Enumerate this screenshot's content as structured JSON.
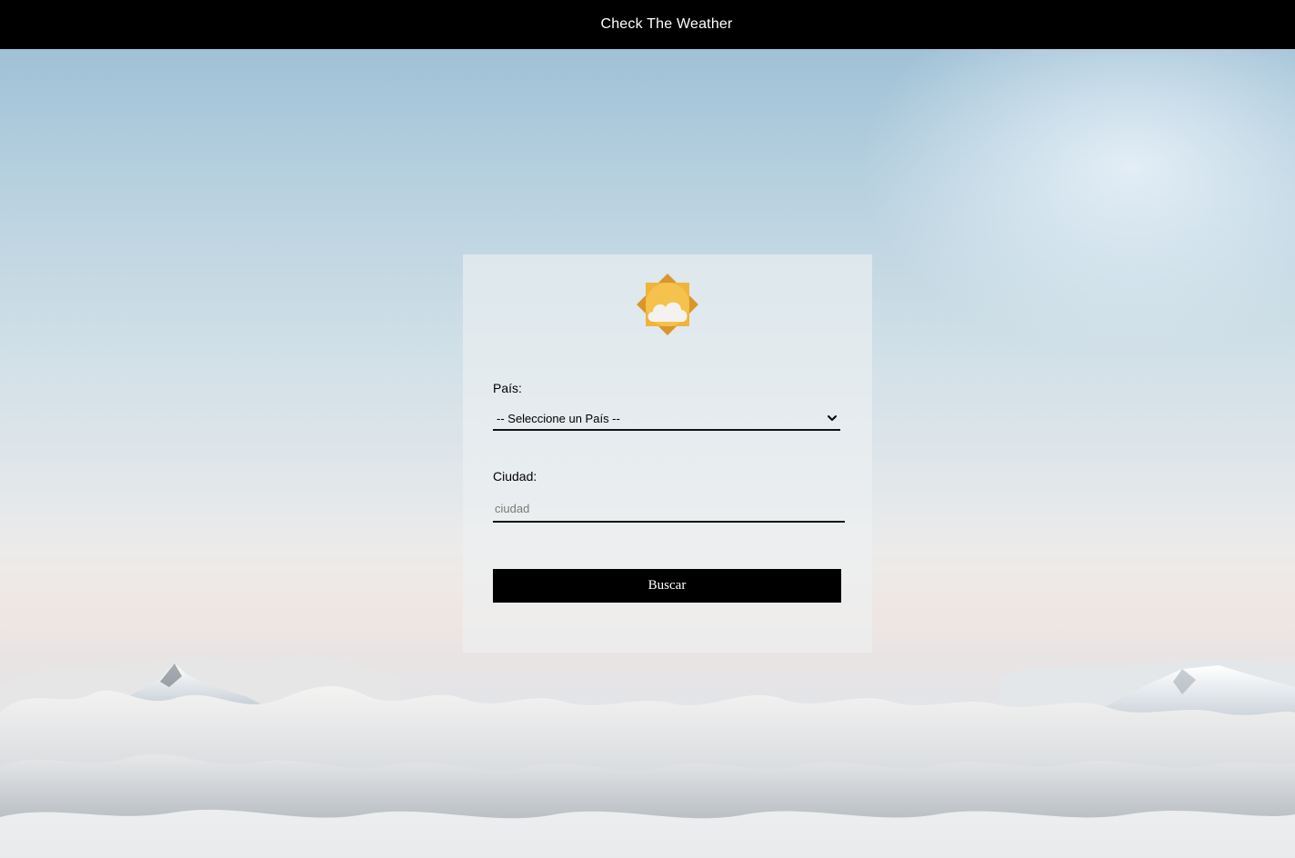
{
  "header": {
    "title": "Check The Weather"
  },
  "form": {
    "logo_icon": "sun-cloud-icon",
    "country": {
      "label": "País:",
      "selected": "-- Seleccione un País --"
    },
    "city": {
      "label": "Ciudad:",
      "placeholder": "ciudad",
      "value": ""
    },
    "submit_label": "Buscar"
  },
  "colors": {
    "topbar": "#000000",
    "button": "#000000",
    "logo_sun": "#f0b43a",
    "logo_cloud": "#f4f2ee"
  }
}
